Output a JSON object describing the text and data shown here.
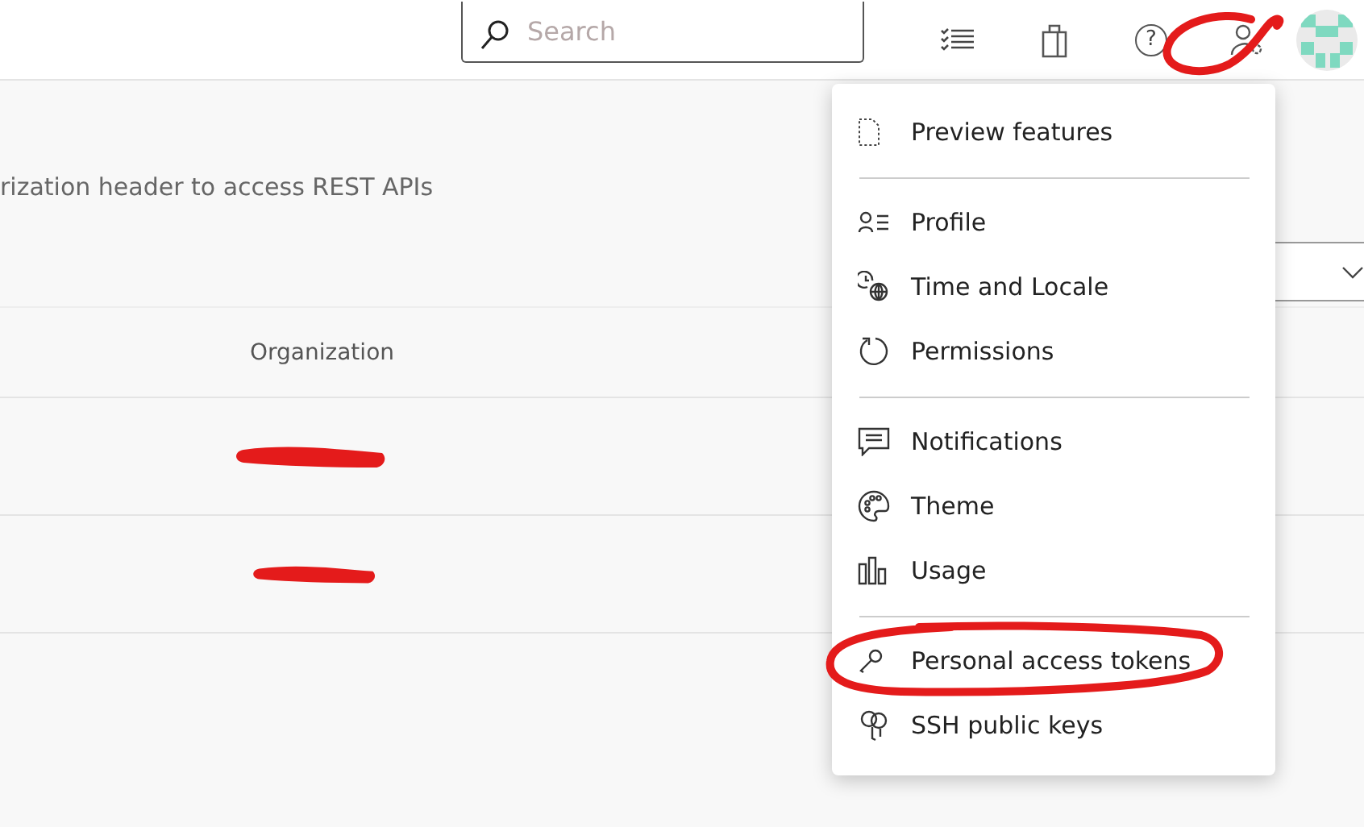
{
  "top_bar": {
    "search": {
      "placeholder": "Search"
    },
    "help_icon": "?"
  },
  "page": {
    "description": "rization header to access REST APIs",
    "table": {
      "columns": [
        "Organization"
      ],
      "rows": [
        {
          "kind": "redacted"
        },
        {
          "kind": "redacted"
        }
      ]
    }
  },
  "user_menu": {
    "groups": [
      [
        {
          "label": "Preview features"
        }
      ],
      [
        {
          "label": "Profile"
        },
        {
          "label": "Time and Locale"
        },
        {
          "label": "Permissions"
        }
      ],
      [
        {
          "label": "Notifications"
        },
        {
          "label": "Theme"
        },
        {
          "label": "Usage"
        }
      ],
      [
        {
          "label": "Personal access tokens",
          "circled": true
        },
        {
          "label": "SSH public keys"
        }
      ]
    ]
  },
  "annotations": {
    "settings_icon_circled": true
  }
}
